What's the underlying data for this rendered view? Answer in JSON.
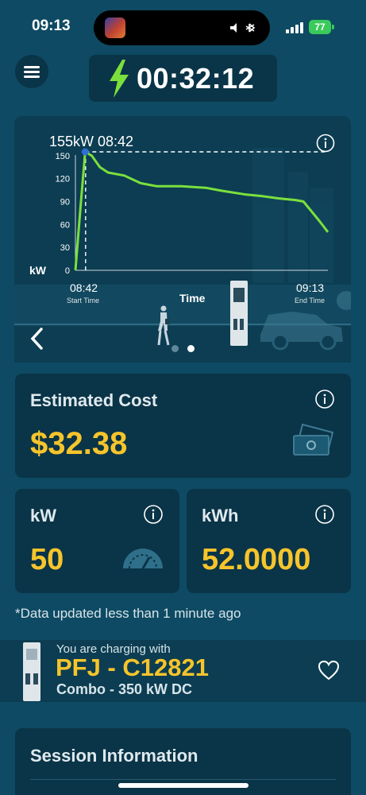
{
  "status_bar": {
    "time": "09:13",
    "battery": "77"
  },
  "header": {
    "elapsed_time": "00:32:12"
  },
  "chart_data": {
    "type": "line",
    "annotation": "155kW 08:42",
    "ylabel": "kW",
    "xlabel": "Time",
    "yticks": [
      0,
      30,
      60,
      90,
      120,
      150
    ],
    "ylim": [
      0,
      155
    ],
    "start_time": "08:42",
    "start_label": "Start Time",
    "end_time": "09:13",
    "end_label": "End Time",
    "series": [
      {
        "x": [
          0,
          0.6,
          1.2,
          2,
          3,
          4,
          6,
          8,
          10,
          13,
          16,
          18,
          21,
          23,
          25,
          27,
          28,
          29,
          30,
          31
        ],
        "values": [
          0,
          80,
          155,
          150,
          135,
          128,
          124,
          114,
          110,
          110,
          108,
          104,
          99,
          97,
          94,
          92,
          90,
          77,
          64,
          50
        ]
      }
    ],
    "peak_line": 155,
    "colors": {
      "line": "#7be03c",
      "peak_dot": "#2f6fd6",
      "dashed": "#ffffff"
    }
  },
  "carousel": {
    "pages": 2,
    "active": 1
  },
  "cost_card": {
    "title": "Estimated Cost",
    "value": "$32.38",
    "icon": "money-icon"
  },
  "kw_card": {
    "title": "kW",
    "value": "50",
    "icon": "gauge-icon"
  },
  "kwh_card": {
    "title": "kWh",
    "value": "52.0000"
  },
  "footnote": "*Data updated less than 1 minute ago",
  "charger": {
    "subtitle": "You are charging with",
    "name": "PFJ - C12821",
    "type": "Combo - 350 kW DC"
  },
  "session": {
    "title": "Session Information"
  },
  "colors": {
    "background": "#0e4a63",
    "card": "#0a3447",
    "accent": "#f6c42b",
    "bolt": "#7be03c"
  }
}
